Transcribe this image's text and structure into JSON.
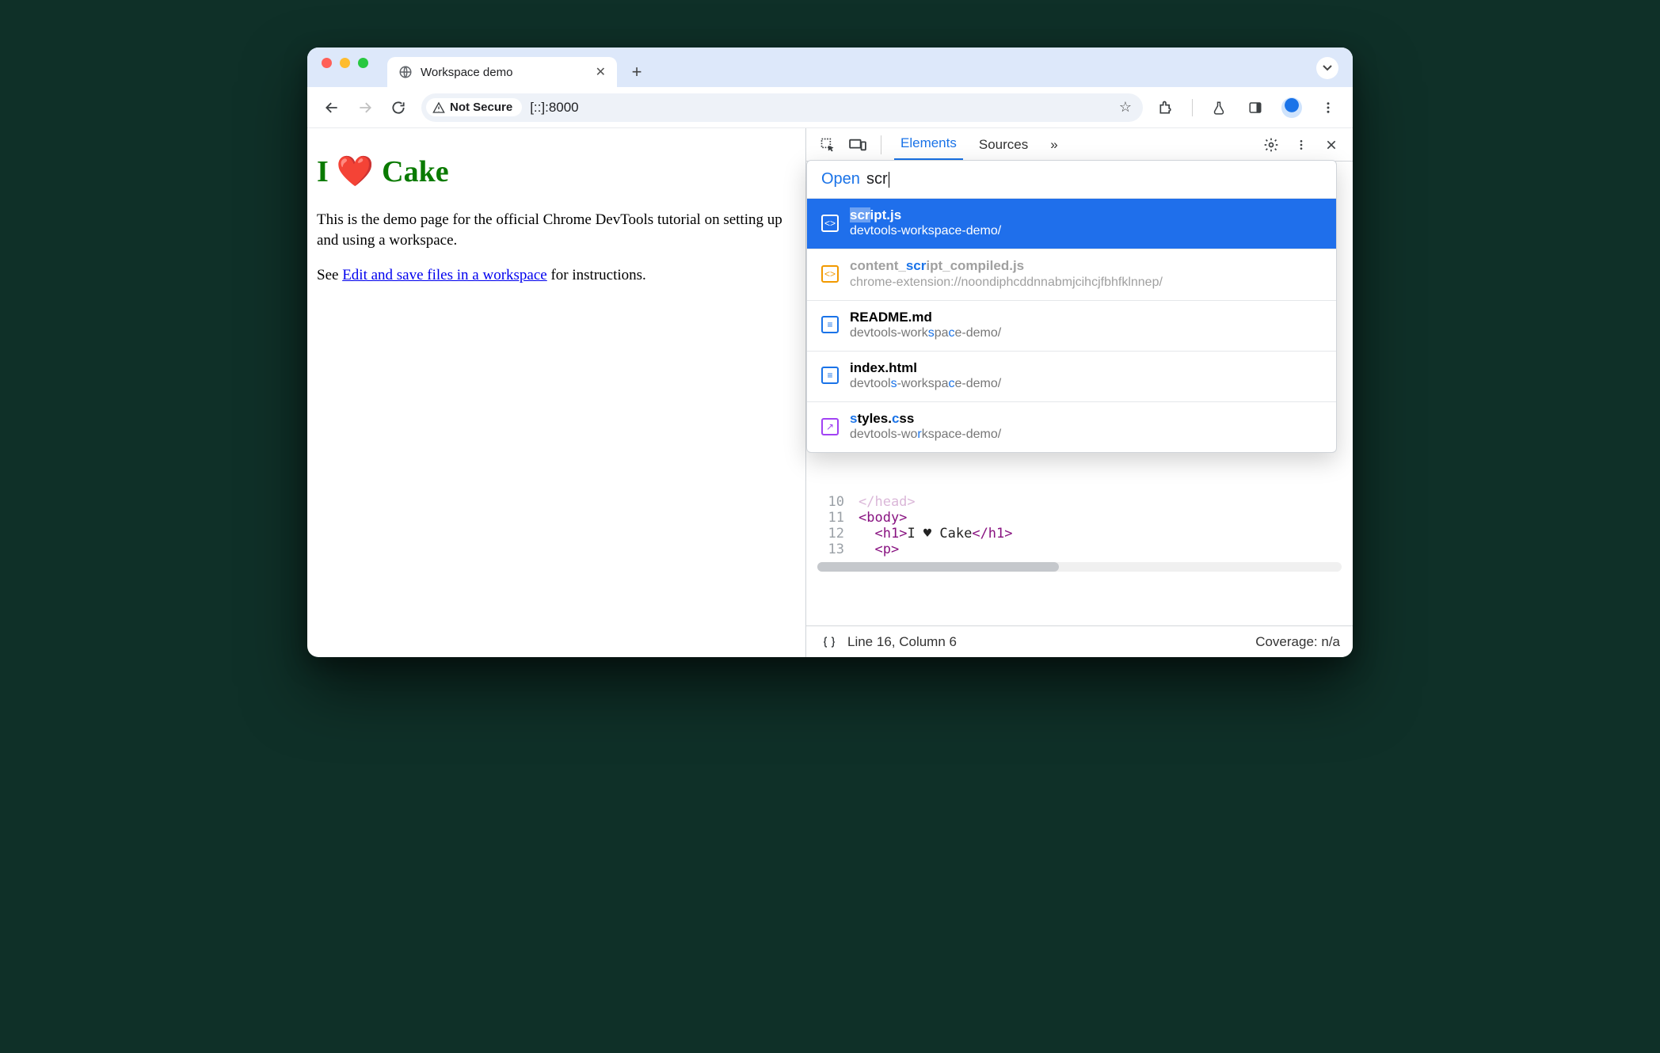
{
  "tab": {
    "title": "Workspace demo"
  },
  "toolbar": {
    "security": "Not Secure",
    "url": "[::]:8000"
  },
  "page": {
    "h1_prefix": "I",
    "h1_emoji": "❤️",
    "h1_suffix": "Cake",
    "intro": "This is the demo page for the official Chrome DevTools tutorial on setting up and using a workspace.",
    "see_prefix": "See ",
    "link_text": "Edit and save files in a workspace",
    "see_suffix": " for instructions."
  },
  "devtools": {
    "tabs": {
      "elements": "Elements",
      "sources": "Sources",
      "more": "»"
    },
    "open_label": "Open",
    "query": "scr",
    "results": [
      {
        "name": "script.js",
        "path": "devtools-workspace-demo/"
      },
      {
        "name": "content_script_compiled.js",
        "path": "chrome-extension://noondiphcddnnabmjcihcjfbhfklnnep/"
      },
      {
        "name": "README.md",
        "path": "devtools-workspace-demo/"
      },
      {
        "name": "index.html",
        "path": "devtools-workspace-demo/"
      },
      {
        "name": "styles.css",
        "path": "devtools-workspace-demo/"
      }
    ],
    "code": {
      "l10": {
        "ln": "10",
        "html": "</head>"
      },
      "l11": {
        "ln": "11",
        "html": "<body>"
      },
      "l12": {
        "ln": "12",
        "open": "<h1>",
        "text": "I ♥ Cake",
        "close": "</h1>"
      },
      "l13": {
        "ln": "13",
        "html": "<p>"
      }
    },
    "status": {
      "pos": "Line 16, Column 6",
      "coverage": "Coverage: n/a"
    }
  }
}
